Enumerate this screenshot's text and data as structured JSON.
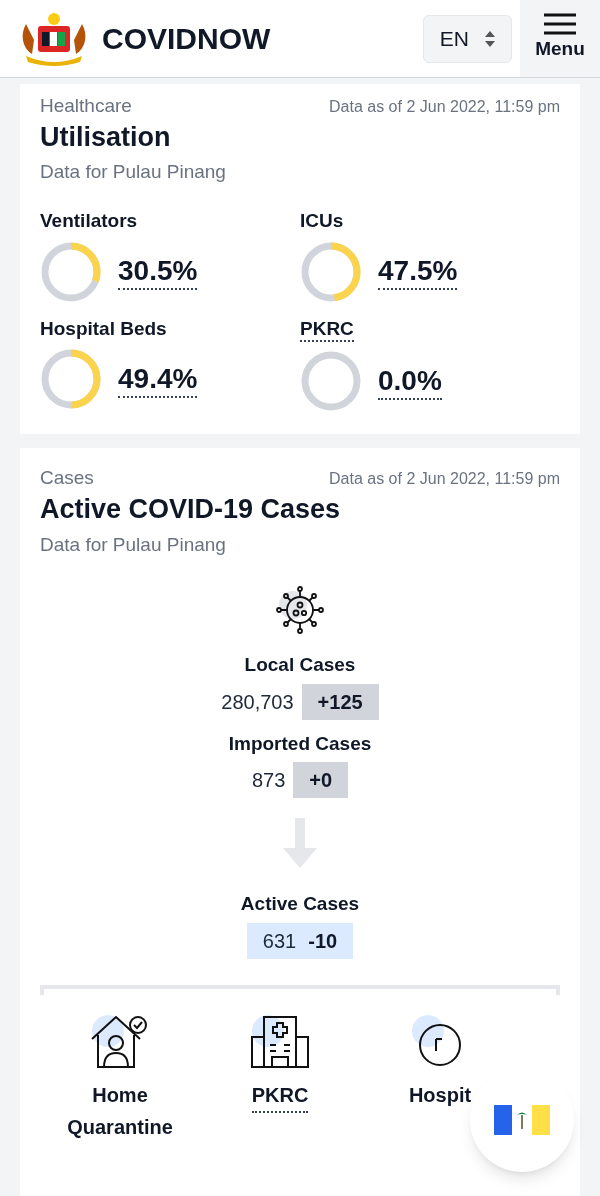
{
  "header": {
    "title": "COVIDNOW",
    "language": "EN",
    "menu_label": "Menu"
  },
  "utilisation": {
    "category": "Healthcare",
    "timestamp": "Data as of 2 Jun 2022, 11:59 pm",
    "title": "Utilisation",
    "subtitle": "Data for Pulau Pinang",
    "metrics": [
      {
        "label": "Ventilators",
        "value": "30.5%",
        "level": 0.305,
        "has_tooltip": false
      },
      {
        "label": "ICUs",
        "value": "47.5%",
        "level": 0.475,
        "has_tooltip": false
      },
      {
        "label": "Hospital Beds",
        "value": "49.4%",
        "level": 0.494,
        "has_tooltip": false
      },
      {
        "label": "PKRC",
        "value": "0.0%",
        "level": 0,
        "has_tooltip": true
      }
    ]
  },
  "cases": {
    "category": "Cases",
    "timestamp": "Data as of 2 Jun 2022, 11:59 pm",
    "title": "Active COVID-19 Cases",
    "subtitle": "Data for Pulau Pinang",
    "local": {
      "label": "Local Cases",
      "total": "280,703",
      "change": "+125"
    },
    "imported": {
      "label": "Imported Cases",
      "total": "873",
      "change": "+0"
    },
    "active": {
      "label": "Active Cases",
      "total": "631",
      "change": "-10"
    }
  },
  "facilities": [
    {
      "kind": "home",
      "label": "Home Quarantine",
      "has_tooltip": false
    },
    {
      "kind": "pkrc",
      "label": "PKRC",
      "has_tooltip": true
    },
    {
      "kind": "hospital",
      "label": "Hospit",
      "has_tooltip": false
    }
  ]
}
